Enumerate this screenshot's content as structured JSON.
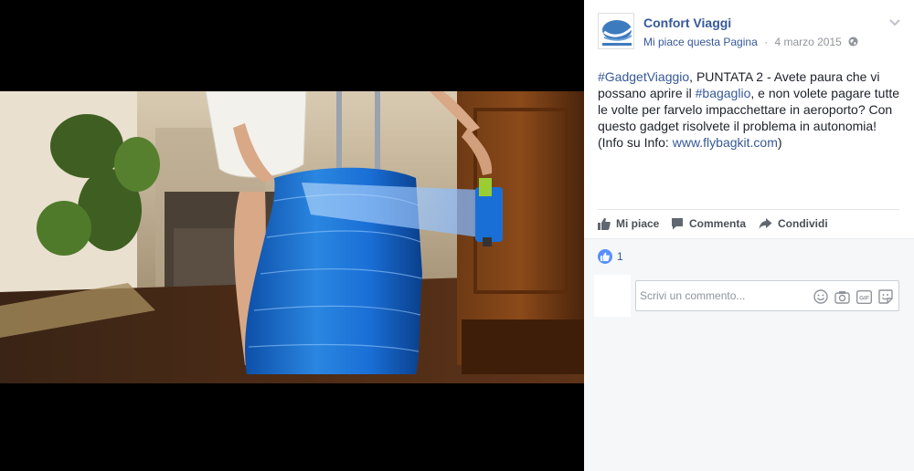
{
  "page": {
    "name": "Confort Viaggi",
    "like_page": "Mi piace questa Pagina",
    "separator": "·",
    "date": "4 marzo 2015"
  },
  "post": {
    "hashtag1": "#GadgetViaggio",
    "text1": ", PUNTATA 2 - Avete paura che vi possano aprire il ",
    "hashtag2": "#bagaglio",
    "text2": ", e non volete pagare tutte le volte per farvelo impacchettare in aeroporto? Con questo gadget risolvete il problema in autonomia! (Info su Info: ",
    "link": "www.flybagkit.com",
    "text3": ")"
  },
  "actions": {
    "like": "Mi piace",
    "comment": "Commenta",
    "share": "Condividi"
  },
  "reactions": {
    "like_count": "1"
  },
  "comment_box": {
    "placeholder": "Scrivi un commento...",
    "gif_label": "GIF"
  },
  "icons": {
    "avatar": "confort-viaggi-logo",
    "globe": "globe-icon",
    "chevron": "chevron-down-icon",
    "like": "thumbs-up-icon",
    "comment": "speech-bubble-icon",
    "share": "share-arrow-icon",
    "emoji": "smiley-icon",
    "camera": "camera-icon",
    "gif": "gif-icon",
    "sticker": "sticker-icon"
  },
  "colors": {
    "link_blue": "#365899",
    "like_blue": "#5890ff",
    "text_dark": "#1d2129",
    "text_grey": "#90949c",
    "wrap_blue": "#1a6fd6"
  }
}
